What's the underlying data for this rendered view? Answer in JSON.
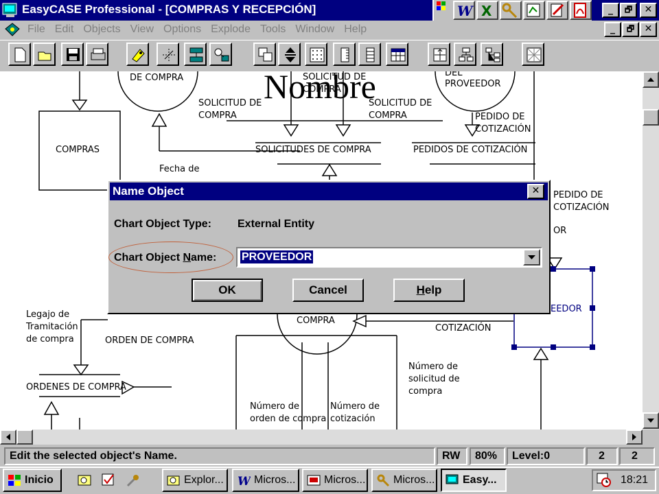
{
  "window": {
    "title": "EasyCASE Professional - [COMPRAS Y RECEPCIÓN]",
    "minimize_glyph": "_",
    "restore_glyph": "🗗",
    "close_glyph": "✕"
  },
  "menu": {
    "items": [
      "File",
      "Edit",
      "Objects",
      "View",
      "Options",
      "Explode",
      "Tools",
      "Window",
      "Help"
    ]
  },
  "overlay_caption": "Nombre",
  "diagram": {
    "labels": {
      "de_compra": "DE COMPRA",
      "solicitud_top_1": "SOLICITUD DE",
      "solicitud_top_2": "COMPRA",
      "del": "DEL",
      "proveedor": "PROVEEDOR",
      "solicitud_left_1": "SOLICITUD DE",
      "solicitud_left_2": "COMPRA",
      "solicitud_right_1": "SOLICITUD DE",
      "solicitud_right_2": "COMPRA",
      "pedido_1": "PEDIDO DE",
      "pedido_2": "COTIZACIÓN",
      "compras": "COMPRAS",
      "solicitudes_de_compra": "SOLICITUDES DE COMPRA",
      "pedidos_de_cotizacion": "PEDIDOS DE COTIZACIÓN",
      "fecha_de": "Fecha de",
      "pedido_r_1": "PEDIDO DE",
      "pedido_r_2": "COTIZACIÓN",
      "or": "OR",
      "eedor": "EEDOR",
      "legajo_1": "Legajo de",
      "legajo_2": "Tramitación",
      "legajo_3": "de compra",
      "compra_mid": "COMPRA",
      "cotizacion_mid": "COTIZACIÓN",
      "orden_de_compra": "ORDEN DE COMPRA",
      "ordenes_de_compra": "ORDENES DE COMPRA",
      "num_sol_1": "Número de",
      "num_sol_2": "solicitud de",
      "num_sol_3": "compra",
      "num_ord_1": "Número de",
      "num_ord_2": "orden de compra",
      "num_cot_1": "Número de",
      "num_cot_2": "cotización"
    }
  },
  "dialog": {
    "title": "Name Object",
    "type_label": "Chart Object Type:",
    "type_value": "External Entity",
    "name_label_pre": "Chart Object ",
    "name_label_key": "N",
    "name_label_post": "ame:",
    "name_value": "PROVEEDOR",
    "ok_label": "OK",
    "cancel_label": "Cancel",
    "help_key": "H",
    "help_rest": "elp",
    "highlight_color": "#c0603a"
  },
  "status": {
    "message": "Edit the selected object's Name.",
    "mode": "RW",
    "zoom": "80%",
    "level": "Level:0",
    "a": "2",
    "b": "2"
  },
  "taskbar": {
    "start": "Inicio",
    "tasks": [
      "Explor...",
      "Micros...",
      "Micros...",
      "Micros...",
      "Easy..."
    ],
    "clock": "18:21"
  },
  "colors": {
    "titlebar": "#000080",
    "desktop_gray": "#c0c0c0",
    "selection_blue": "#000080"
  }
}
